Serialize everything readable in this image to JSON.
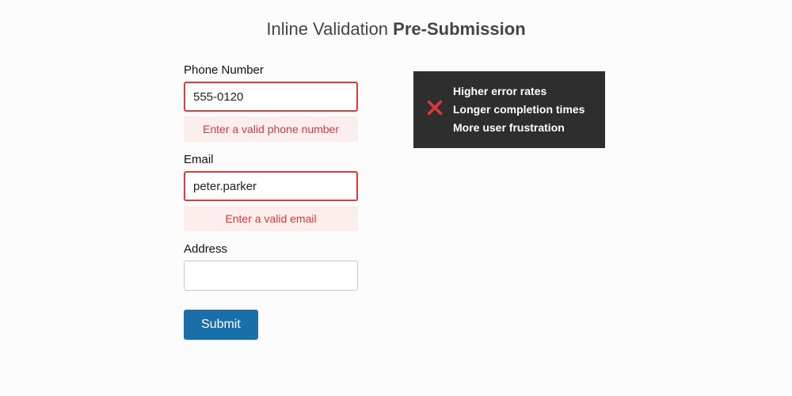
{
  "heading": {
    "prefix": "Inline Validation ",
    "bold": "Pre-Submission"
  },
  "form": {
    "phone": {
      "label": "Phone Number",
      "value": "555-0120",
      "error": "Enter a valid phone number"
    },
    "email": {
      "label": "Email",
      "value": "peter.parker",
      "error": "Enter a valid email"
    },
    "address": {
      "label": "Address",
      "value": ""
    },
    "submit_label": "Submit"
  },
  "callout": {
    "icon": "cross-icon",
    "items": [
      "Higher error rates",
      "Longer completion times",
      "More user frustration"
    ]
  },
  "colors": {
    "error_red": "#e33a3a",
    "error_bg": "#fdeeee",
    "callout_bg": "#2e2e2e",
    "submit_bg": "#1b6fa8"
  }
}
